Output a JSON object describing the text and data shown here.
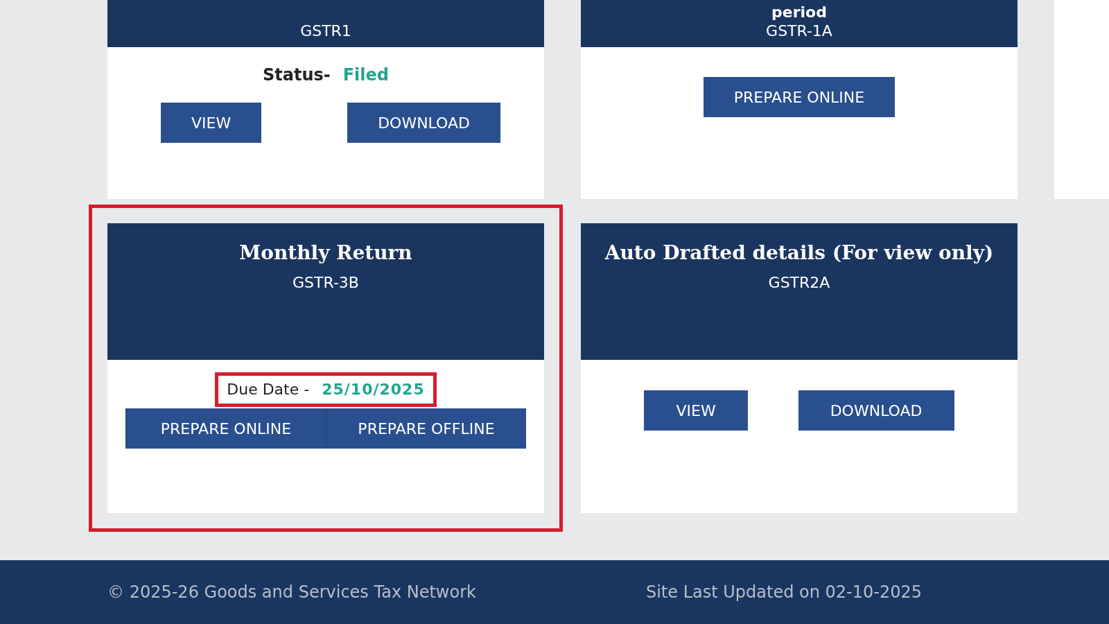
{
  "top_cards": [
    {
      "header_lines": [
        "GSTR1"
      ],
      "status": {
        "label": "Status-",
        "value": "Filed"
      },
      "buttons": [
        "VIEW",
        "DOWNLOAD"
      ]
    },
    {
      "header_lines": [
        "period",
        "GSTR-1A"
      ],
      "buttons": [
        "PREPARE ONLINE"
      ]
    }
  ],
  "bottom_cards": [
    {
      "title": "Monthly Return",
      "code": "GSTR-3B",
      "highlighted": true,
      "due": {
        "label": "Due Date -",
        "value": "25/10/2025",
        "highlighted": true
      },
      "buttons": [
        "PREPARE ONLINE",
        "PREPARE OFFLINE"
      ]
    },
    {
      "title": "Auto Drafted details (For view only)",
      "code": "GSTR2A",
      "highlighted": false,
      "buttons": [
        "VIEW",
        "DOWNLOAD"
      ]
    }
  ],
  "footer": {
    "copyright": "© 2025-26 Goods and Services Tax Network",
    "updated": "Site Last Updated on 02-10-2025"
  }
}
